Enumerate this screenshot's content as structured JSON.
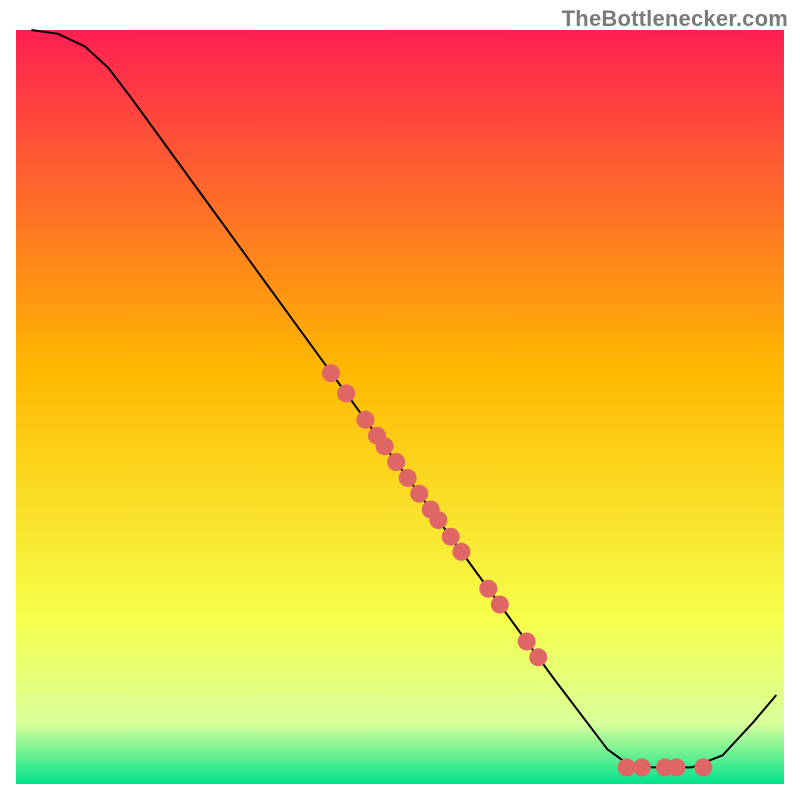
{
  "watermark": "TheBottlenecker.com",
  "chart_data": {
    "type": "line",
    "title": "",
    "xlabel": "",
    "ylabel": "",
    "xlim": [
      0,
      100
    ],
    "ylim": [
      0,
      100
    ],
    "axes_visible": false,
    "grid": false,
    "background_gradient": {
      "top": "#ff1f52",
      "mid1": "#ffb800",
      "mid2": "#f6ff4a",
      "band": "#d8ff9b",
      "bottom": "#00e28a"
    },
    "line": {
      "color": "#000000",
      "stroke_width": 2,
      "points": [
        {
          "x": 2.0,
          "y": 100.0
        },
        {
          "x": 5.5,
          "y": 99.5
        },
        {
          "x": 9.0,
          "y": 97.8
        },
        {
          "x": 12.0,
          "y": 95.0
        },
        {
          "x": 15.0,
          "y": 91.0
        },
        {
          "x": 20.0,
          "y": 84.0
        },
        {
          "x": 30.0,
          "y": 70.0
        },
        {
          "x": 40.0,
          "y": 56.0
        },
        {
          "x": 50.0,
          "y": 42.0
        },
        {
          "x": 60.0,
          "y": 28.0
        },
        {
          "x": 70.0,
          "y": 14.0
        },
        {
          "x": 77.0,
          "y": 4.6
        },
        {
          "x": 80.0,
          "y": 2.4
        },
        {
          "x": 83.0,
          "y": 2.2
        },
        {
          "x": 88.0,
          "y": 2.2
        },
        {
          "x": 92.0,
          "y": 3.8
        },
        {
          "x": 96.0,
          "y": 8.2
        },
        {
          "x": 99.0,
          "y": 11.8
        }
      ]
    },
    "scatter": {
      "color": "#e06666",
      "radius": 9,
      "points": [
        {
          "x": 41.0,
          "y": 54.5
        },
        {
          "x": 43.0,
          "y": 51.8
        },
        {
          "x": 45.5,
          "y": 48.3
        },
        {
          "x": 47.0,
          "y": 46.2
        },
        {
          "x": 48.0,
          "y": 44.8
        },
        {
          "x": 49.5,
          "y": 42.7
        },
        {
          "x": 51.0,
          "y": 40.6
        },
        {
          "x": 52.5,
          "y": 38.5
        },
        {
          "x": 54.0,
          "y": 36.4
        },
        {
          "x": 55.0,
          "y": 35.0
        },
        {
          "x": 56.6,
          "y": 32.8
        },
        {
          "x": 58.0,
          "y": 30.8
        },
        {
          "x": 61.5,
          "y": 25.9
        },
        {
          "x": 63.0,
          "y": 23.8
        },
        {
          "x": 66.5,
          "y": 18.9
        },
        {
          "x": 68.0,
          "y": 16.8
        },
        {
          "x": 79.5,
          "y": 2.2
        },
        {
          "x": 81.5,
          "y": 2.2
        },
        {
          "x": 84.5,
          "y": 2.2
        },
        {
          "x": 86.0,
          "y": 2.2
        },
        {
          "x": 89.5,
          "y": 2.2
        }
      ]
    }
  }
}
